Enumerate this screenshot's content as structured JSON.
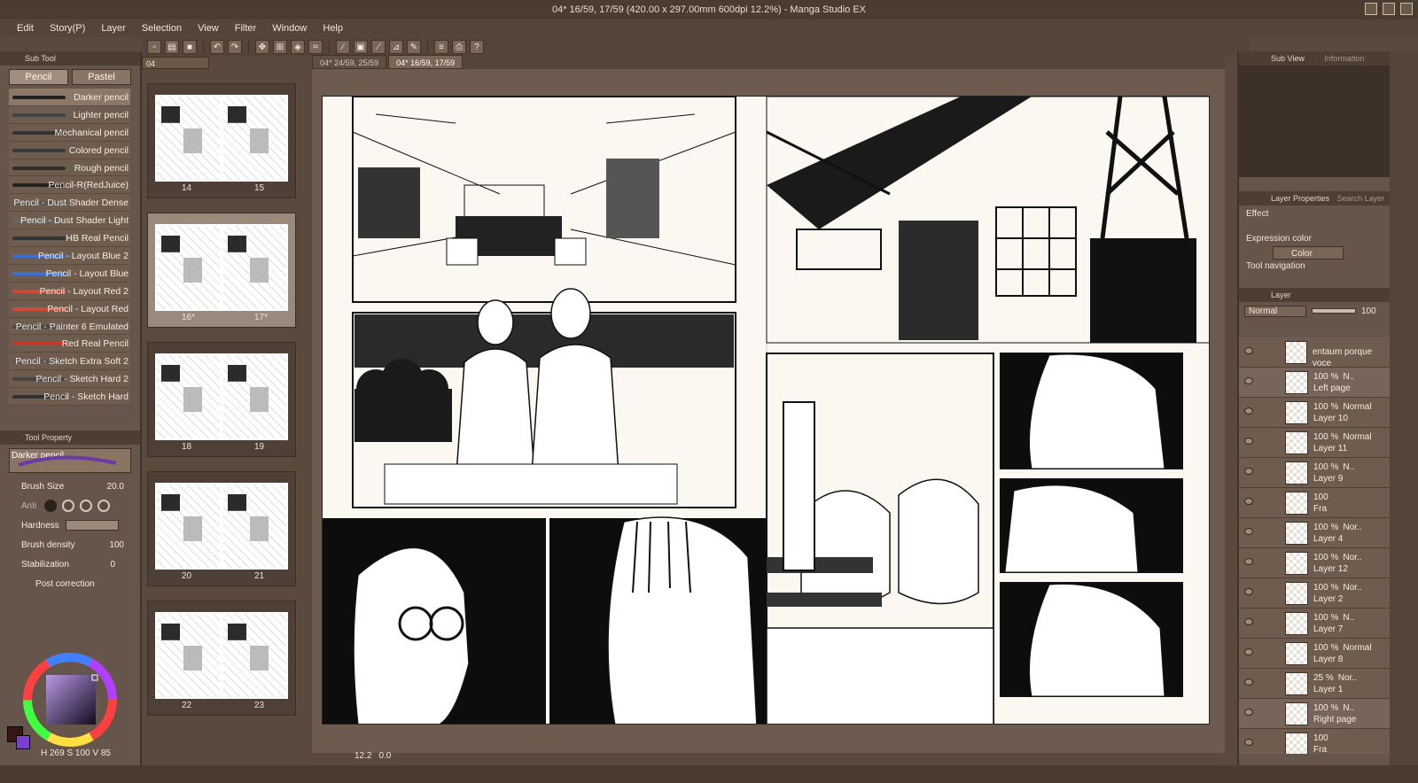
{
  "window": {
    "title": "04* 16/59, 17/59 (420.00 x 297.00mm 600dpi 12.2%) - Manga Studio EX"
  },
  "menu": [
    "Edit",
    "Story(P)",
    "Layer",
    "Selection",
    "View",
    "Filter",
    "Window",
    "Help"
  ],
  "sub_tool": {
    "panel_title": "Sub Tool",
    "tabs": [
      "Pencil",
      "Pastel"
    ],
    "brushes": [
      "Darker pencil",
      "Lighter pencil",
      "Mechanical pencil",
      "Colored pencil",
      "Rough pencil",
      "Pencil-R(RedJuice)",
      "Pencil - Dust Shader Dense",
      "Pencil - Dust Shader Light",
      "HB Real Pencil",
      "Pencil - Layout Blue 2",
      "Pencil - Layout Blue",
      "Pencil - Layout Red 2",
      "Pencil - Layout Red",
      "Pencil - Painter 6 Emulated",
      "Red Real Pencil",
      "Pencil - Sketch Extra Soft 2",
      "Pencil - Sketch Hard 2",
      "Pencil - Sketch Hard"
    ],
    "selected_brush": "Darker pencil"
  },
  "tool_property": {
    "panel_title": "Tool Property",
    "brush_name": "Darker pencil",
    "brush_size_label": "Brush Size",
    "brush_size_value": "20.0",
    "anti_label": "Anti",
    "hardness_label": "Hardness",
    "brush_density_label": "Brush density",
    "brush_density_value": "100",
    "stabilization_label": "Stabilization",
    "stabilization_value": "0",
    "post_correction_label": "Post correction"
  },
  "color": {
    "hsv": "H 269 S 100 V 85",
    "main": "#3b1414",
    "sub": "#7b3fd1"
  },
  "pages": {
    "file_tab": "04",
    "spreads": [
      {
        "left": "14",
        "right": "15"
      },
      {
        "left": "16*",
        "right": "17*"
      },
      {
        "left": "18",
        "right": "19"
      },
      {
        "left": "20",
        "right": "21"
      },
      {
        "left": "22",
        "right": "23"
      }
    ]
  },
  "doc_tabs": [
    "04* 24/59, 25/59",
    "04* 16/59, 17/59"
  ],
  "zoom": "12.2",
  "rotation": "0.0",
  "sub_view": {
    "tabs": [
      "Sub View",
      "Information"
    ]
  },
  "layer_property": {
    "tabs": [
      "Layer Properties",
      "Search Layer"
    ],
    "effect_label": "Effect",
    "expression_color_label": "Expression color",
    "expression_color_value": "Color",
    "tool_navigation_label": "Tool navigation"
  },
  "layers_panel": {
    "tab": "Layer",
    "blend_mode": "Normal",
    "opacity": "100",
    "layers": [
      {
        "name": "entaum porque voce",
        "opacity": "",
        "mode": ""
      },
      {
        "name": "Left page",
        "opacity": "100 %",
        "mode": "N.."
      },
      {
        "name": "Layer 10",
        "opacity": "100 %",
        "mode": "Normal"
      },
      {
        "name": "Layer 11",
        "opacity": "100 %",
        "mode": "Normal"
      },
      {
        "name": "Layer 9",
        "opacity": "100 %",
        "mode": "N.."
      },
      {
        "name": "Fra",
        "opacity": "100",
        "mode": ""
      },
      {
        "name": "Layer 4",
        "opacity": "100 %",
        "mode": "Nor.."
      },
      {
        "name": "Layer 12",
        "opacity": "100 %",
        "mode": "Nor.."
      },
      {
        "name": "Layer 2",
        "opacity": "100 %",
        "mode": "Nor.."
      },
      {
        "name": "Layer 7",
        "opacity": "100 %",
        "mode": "N.."
      },
      {
        "name": "Layer 8",
        "opacity": "100 %",
        "mode": "Normal"
      },
      {
        "name": "Layer 1",
        "opacity": "25 %",
        "mode": "Nor.."
      },
      {
        "name": "Right page",
        "opacity": "100 %",
        "mode": "N.."
      },
      {
        "name": "Fra",
        "opacity": "100",
        "mode": ""
      }
    ]
  }
}
